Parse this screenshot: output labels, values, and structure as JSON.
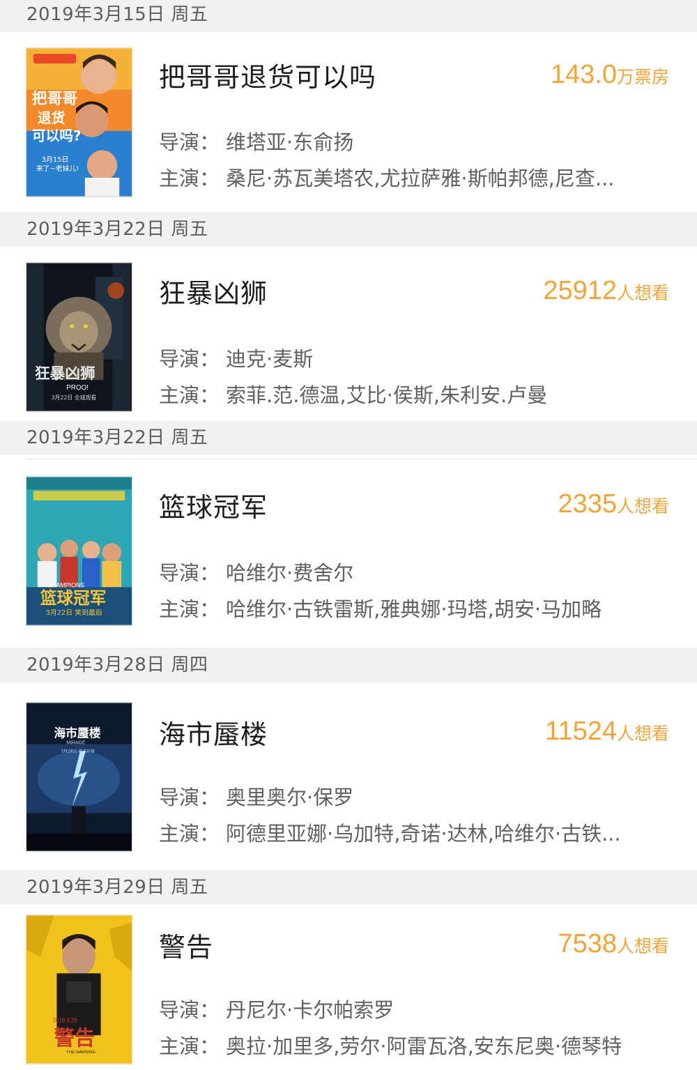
{
  "colors": {
    "accent": "#f2a43a",
    "header_bg": "#f1f1f1",
    "title": "#1d1d1d",
    "info": "#606060"
  },
  "director_label": "导演：",
  "cast_label": "主演：",
  "sections": [
    {
      "date": "2019年3月15日 周五",
      "movie": {
        "title": "把哥哥退货可以吗",
        "stat_value": "143.0",
        "stat_unit": "万票房",
        "director": "维塔亚·东俞扬",
        "cast": "桑尼·苏瓦美塔农,尤拉萨雅·斯帕邦德,尼查...",
        "poster_icon": "poster-comedy"
      }
    },
    {
      "date": "2019年3月22日 周五",
      "movie": {
        "title": "狂暴凶狮",
        "stat_value": "25912",
        "stat_unit": "人想看",
        "director": "迪克·麦斯",
        "cast": "索菲.范.德温,艾比·侯斯,朱利安.卢曼",
        "poster_icon": "poster-lion"
      }
    },
    {
      "date": "2019年3月22日 周五",
      "movie": {
        "title": "篮球冠军",
        "stat_value": "2335",
        "stat_unit": "人想看",
        "director": "哈维尔·费舍尔",
        "cast": "哈维尔·古铁雷斯,雅典娜·玛塔,胡安·马加略",
        "poster_icon": "poster-basketball"
      }
    },
    {
      "date": "2019年3月28日 周四",
      "movie": {
        "title": "海市蜃楼",
        "stat_value": "11524",
        "stat_unit": "人想看",
        "director": "奥里奥尔·保罗",
        "cast": "阿德里亚娜·乌加特,奇诺·达林,哈维尔·古铁...",
        "poster_icon": "poster-storm"
      }
    },
    {
      "date": "2019年3月29日 周五",
      "movie": {
        "title": "警告",
        "stat_value": "7538",
        "stat_unit": "人想看",
        "director": "丹尼尔·卡尔帕索罗",
        "cast": "奥拉·加里多,劳尔·阿雷瓦洛,安东尼奥·德琴特",
        "poster_icon": "poster-warning"
      }
    }
  ]
}
